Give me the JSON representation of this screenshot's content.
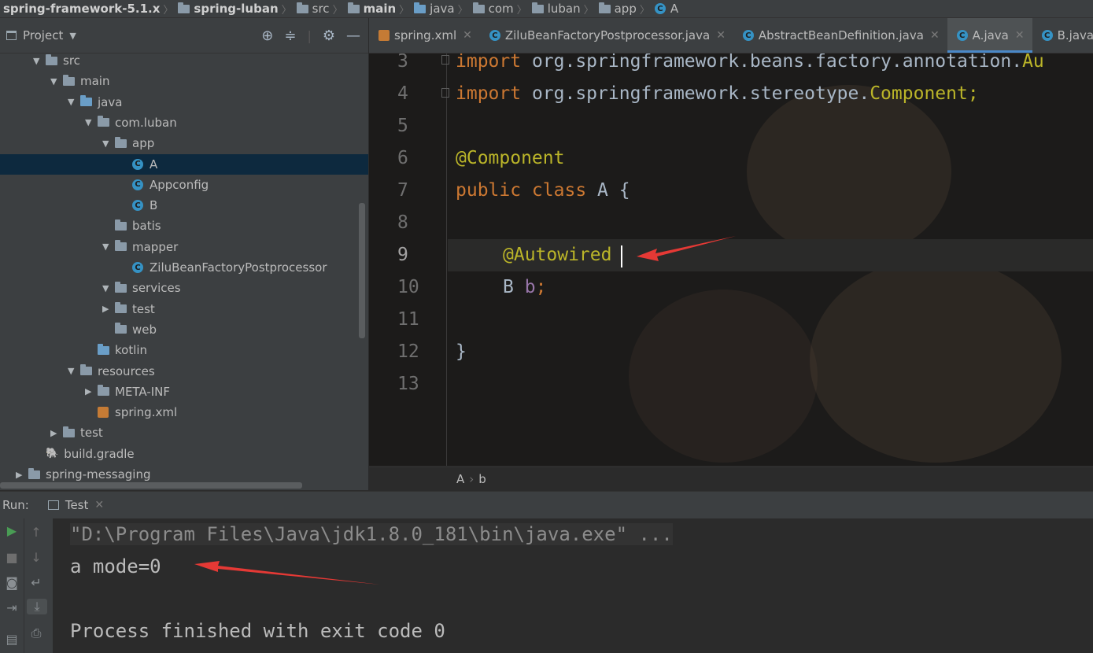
{
  "breadcrumb": [
    "spring-framework-5.1.x",
    "spring-luban",
    "src",
    "main",
    "java",
    "com",
    "luban",
    "app",
    "A"
  ],
  "project": {
    "title": "Project",
    "tree": [
      {
        "label": "src",
        "depth": 0,
        "arrow": "open",
        "icon": "folder"
      },
      {
        "label": "main",
        "depth": 1,
        "arrow": "open",
        "icon": "folder"
      },
      {
        "label": "java",
        "depth": 2,
        "arrow": "open",
        "icon": "folder-blue"
      },
      {
        "label": "com.luban",
        "depth": 3,
        "arrow": "open",
        "icon": "package"
      },
      {
        "label": "app",
        "depth": 4,
        "arrow": "open",
        "icon": "package"
      },
      {
        "label": "A",
        "depth": 5,
        "arrow": "none",
        "icon": "class",
        "selected": true
      },
      {
        "label": "Appconfig",
        "depth": 5,
        "arrow": "none",
        "icon": "class"
      },
      {
        "label": "B",
        "depth": 5,
        "arrow": "none",
        "icon": "class"
      },
      {
        "label": "batis",
        "depth": 4,
        "arrow": "none",
        "icon": "package"
      },
      {
        "label": "mapper",
        "depth": 4,
        "arrow": "open",
        "icon": "package"
      },
      {
        "label": "ZiluBeanFactoryPostprocessor",
        "depth": 5,
        "arrow": "none",
        "icon": "class"
      },
      {
        "label": "services",
        "depth": 4,
        "arrow": "open",
        "icon": "package"
      },
      {
        "label": "test",
        "depth": 4,
        "arrow": "closed",
        "icon": "package"
      },
      {
        "label": "web",
        "depth": 4,
        "arrow": "none",
        "icon": "package"
      },
      {
        "label": "kotlin",
        "depth": 3,
        "arrow": "none",
        "icon": "folder-blue"
      },
      {
        "label": "resources",
        "depth": 2,
        "arrow": "open",
        "icon": "folder"
      },
      {
        "label": "META-INF",
        "depth": 3,
        "arrow": "closed",
        "icon": "folder"
      },
      {
        "label": "spring.xml",
        "depth": 3,
        "arrow": "none",
        "icon": "xml"
      },
      {
        "label": "test",
        "depth": 1,
        "arrow": "closed",
        "icon": "folder"
      },
      {
        "label": "build.gradle",
        "depth": 0,
        "arrow": "none",
        "icon": "gradle"
      },
      {
        "label": "spring-messaging",
        "depth": -1,
        "arrow": "closed",
        "icon": "folder"
      }
    ]
  },
  "tabs": [
    {
      "label": "spring.xml",
      "icon": "xml"
    },
    {
      "label": "ZiluBeanFactoryPostprocessor.java",
      "icon": "class"
    },
    {
      "label": "AbstractBeanDefinition.java",
      "icon": "class"
    },
    {
      "label": "A.java",
      "icon": "class",
      "active": true
    },
    {
      "label": "B.java",
      "icon": "class"
    }
  ],
  "editor": {
    "line_numbers": [
      "3",
      "4",
      "5",
      "6",
      "7",
      "8",
      "9",
      "10",
      "11",
      "12",
      "13"
    ],
    "lines": {
      "l3_kw": "import",
      "l3_rest": " org.springframework.beans.factory.annotation.",
      "l3_tail": "Au",
      "l4_kw": "import",
      "l4_rest": " org.springframework.stereotype.",
      "l4_tail": "Component;",
      "l6": "@Component",
      "l7_kw": "public class",
      "l7_rest": " A {",
      "l9": "@Autowired",
      "l10_type": "B ",
      "l10_field": "b",
      "l10_end": ";",
      "l12": "}"
    },
    "breadcrumb": [
      "A",
      "b"
    ]
  },
  "run": {
    "label": "Run:",
    "tab": "Test",
    "output": [
      "\"D:\\Program Files\\Java\\jdk1.8.0_181\\bin\\java.exe\" ...",
      "a mode=0",
      "",
      "Process finished with exit code 0"
    ]
  },
  "colors": {
    "accent": "#4a88c7",
    "annotation_arrow": "#e53935",
    "selection": "#0d293e"
  }
}
